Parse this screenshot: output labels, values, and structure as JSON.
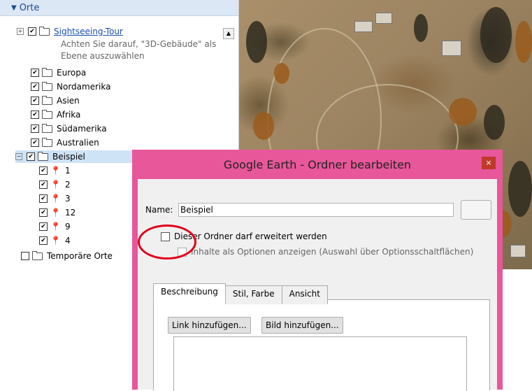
{
  "places": {
    "header": "Orte",
    "items": [
      {
        "label": "Sightseeing-Tour",
        "note": "Achten Sie darauf, \"3D-Gebäude\" als",
        "note2": "Ebene auszuwählen"
      },
      {
        "label": "Europa"
      },
      {
        "label": "Nordamerika"
      },
      {
        "label": "Asien"
      },
      {
        "label": "Afrika"
      },
      {
        "label": "Südamerika"
      },
      {
        "label": "Australien"
      },
      {
        "label": "Beispiel"
      },
      {
        "label": "1",
        "pin_color": "#e6c21a"
      },
      {
        "label": "2",
        "pin_color": "#2a56c8"
      },
      {
        "label": "3",
        "pin_color": "#2fb52f"
      },
      {
        "label": "12",
        "pin_color": "#e6c21a"
      },
      {
        "label": "9",
        "pin_color": "#e6c21a"
      },
      {
        "label": "4",
        "pin_color": "#e6c21a"
      },
      {
        "label": "Temporäre Orte"
      }
    ]
  },
  "dialog": {
    "title": "Google Earth - Ordner bearbeiten",
    "close": "×",
    "name_label": "Name:",
    "name_value": "Beispiel",
    "expand_checkbox": "Dieser Ordner darf erweitert werden",
    "options_checkbox": "Inhalte als Optionen anzeigen (Auswahl über Optionsschaltflächen)",
    "tabs": [
      "Beschreibung",
      "Stil, Farbe",
      "Ansicht"
    ],
    "add_link": "Link hinzufügen...",
    "add_image": "Bild hinzufügen..."
  },
  "colors": {
    "dialog_frame": "#e8579a",
    "highlight": "#e0001a"
  }
}
